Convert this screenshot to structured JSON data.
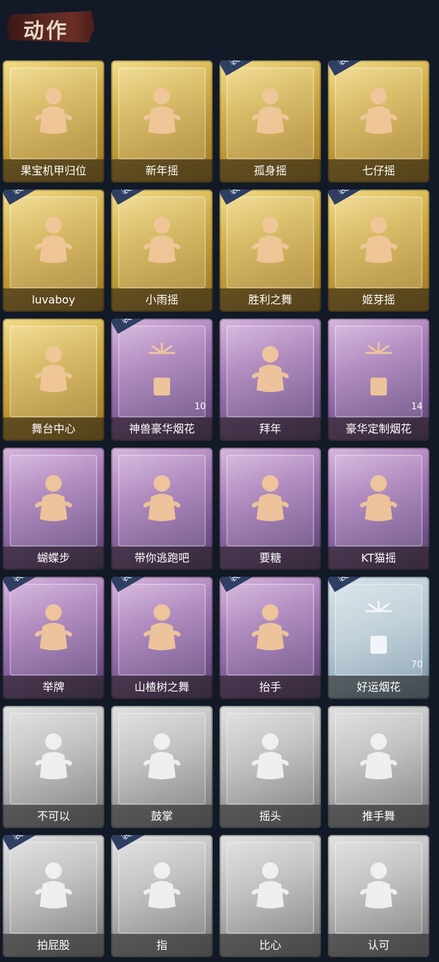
{
  "header": {
    "title": "动作"
  },
  "cards": [
    {
      "label": "果宝机甲归位",
      "theme": "gold",
      "equipped": false,
      "count": ""
    },
    {
      "label": "新年摇",
      "theme": "gold",
      "equipped": false,
      "count": ""
    },
    {
      "label": "孤身摇",
      "theme": "gold",
      "equipped": true,
      "count": ""
    },
    {
      "label": "七仔摇",
      "theme": "gold",
      "equipped": true,
      "count": ""
    },
    {
      "label": "luvaboy",
      "theme": "gold",
      "equipped": true,
      "count": ""
    },
    {
      "label": "小雨摇",
      "theme": "gold",
      "equipped": true,
      "count": ""
    },
    {
      "label": "胜利之舞",
      "theme": "gold",
      "equipped": true,
      "count": ""
    },
    {
      "label": "姬芽摇",
      "theme": "gold",
      "equipped": true,
      "count": ""
    },
    {
      "label": "舞台中心",
      "theme": "gold",
      "equipped": false,
      "count": ""
    },
    {
      "label": "神兽豪华烟花",
      "theme": "purple",
      "equipped": true,
      "count": "10"
    },
    {
      "label": "拜年",
      "theme": "purple",
      "equipped": false,
      "count": ""
    },
    {
      "label": "豪华定制烟花",
      "theme": "purple",
      "equipped": false,
      "count": "14"
    },
    {
      "label": "蝴蝶步",
      "theme": "purple",
      "equipped": false,
      "count": ""
    },
    {
      "label": "带你逃跑吧",
      "theme": "purple",
      "equipped": false,
      "count": ""
    },
    {
      "label": "要糖",
      "theme": "purple",
      "equipped": false,
      "count": ""
    },
    {
      "label": "KT猫摇",
      "theme": "purple",
      "equipped": false,
      "count": ""
    },
    {
      "label": "举牌",
      "theme": "purple",
      "equipped": true,
      "count": ""
    },
    {
      "label": "山楂树之舞",
      "theme": "purple",
      "equipped": true,
      "count": ""
    },
    {
      "label": "抬手",
      "theme": "purple",
      "equipped": true,
      "count": ""
    },
    {
      "label": "好运烟花",
      "theme": "blue",
      "equipped": true,
      "count": "70"
    },
    {
      "label": "不可以",
      "theme": "gray",
      "equipped": false,
      "count": ""
    },
    {
      "label": "鼓掌",
      "theme": "gray",
      "equipped": false,
      "count": ""
    },
    {
      "label": "摇头",
      "theme": "gray",
      "equipped": false,
      "count": ""
    },
    {
      "label": "推手舞",
      "theme": "gray",
      "equipped": false,
      "count": ""
    },
    {
      "label": "拍屁股",
      "theme": "gray",
      "equipped": true,
      "count": ""
    },
    {
      "label": "指",
      "theme": "gray",
      "equipped": true,
      "count": ""
    },
    {
      "label": "比心",
      "theme": "gray",
      "equipped": false,
      "count": ""
    },
    {
      "label": "认可",
      "theme": "gray",
      "equipped": false,
      "count": ""
    }
  ],
  "equip_text": "装配"
}
